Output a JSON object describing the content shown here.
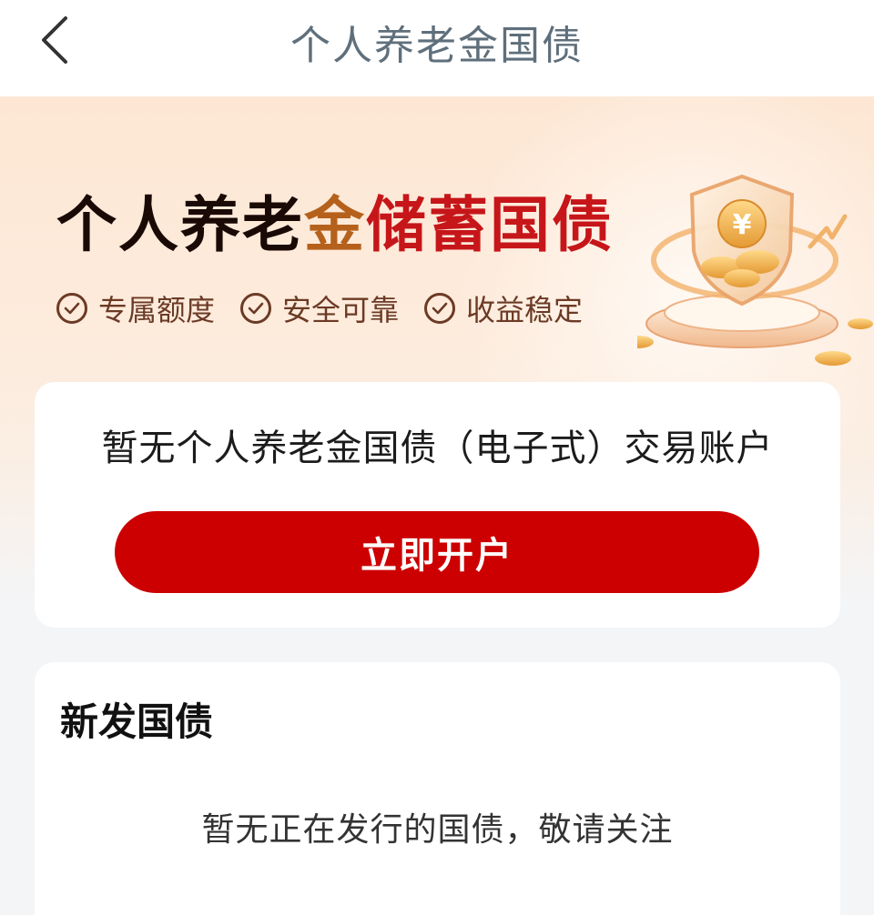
{
  "header": {
    "title": "个人养老金国债"
  },
  "banner": {
    "headline_part1": "个人养老",
    "headline_part2": "金",
    "headline_part3": "储蓄国债",
    "features": [
      "专属额度",
      "安全可靠",
      "收益稳定"
    ],
    "colors": {
      "headline_dark": "#1a0a06",
      "headline_gold": "#b5611c",
      "headline_red": "#c6161a"
    }
  },
  "account": {
    "message": "暂无个人养老金国债（电子式）交易账户",
    "open_button_label": "立即开户",
    "button_color": "#cc0000"
  },
  "new_bonds": {
    "title": "新发国债",
    "empty_message": "暂无正在发行的国债，敬请关注"
  }
}
